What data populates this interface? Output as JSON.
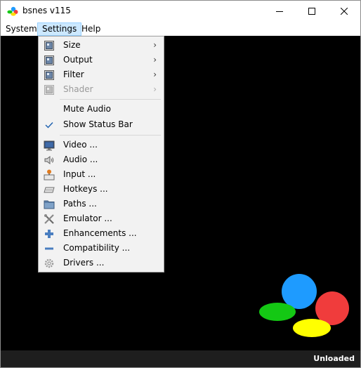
{
  "window": {
    "title": "bsnes v115"
  },
  "menubar": {
    "items": [
      {
        "label": "System"
      },
      {
        "label": "Settings"
      },
      {
        "label": "Help"
      }
    ]
  },
  "settings_menu": {
    "items": [
      {
        "label": "Size",
        "icon": "display-icon",
        "submenu": true,
        "enabled": true
      },
      {
        "label": "Output",
        "icon": "display-icon",
        "submenu": true,
        "enabled": true
      },
      {
        "label": "Filter",
        "icon": "display-icon",
        "submenu": true,
        "enabled": true
      },
      {
        "label": "Shader",
        "icon": "display-icon",
        "submenu": true,
        "enabled": false
      },
      {
        "label": "Mute Audio",
        "checked": false,
        "enabled": true
      },
      {
        "label": "Show Status Bar",
        "checked": true,
        "enabled": true
      },
      {
        "label": "Video ...",
        "icon": "monitor-icon",
        "enabled": true
      },
      {
        "label": "Audio ...",
        "icon": "speaker-icon",
        "enabled": true
      },
      {
        "label": "Input ...",
        "icon": "joystick-icon",
        "enabled": true
      },
      {
        "label": "Hotkeys ...",
        "icon": "keyboard-icon",
        "enabled": true
      },
      {
        "label": "Paths ...",
        "icon": "folder-icon",
        "enabled": true
      },
      {
        "label": "Emulator ...",
        "icon": "tools-icon",
        "enabled": true
      },
      {
        "label": "Enhancements ...",
        "icon": "plus-icon",
        "enabled": true
      },
      {
        "label": "Compatibility ...",
        "icon": "minus-icon",
        "enabled": true
      },
      {
        "label": "Drivers ...",
        "icon": "gear-icon",
        "enabled": true
      }
    ],
    "arrow_glyph": "›"
  },
  "statusbar": {
    "text": "Unloaded"
  },
  "colors": {
    "menu_highlight": "#cce8ff",
    "logo_blue": "#1e9bff",
    "logo_red": "#f03c3c",
    "logo_green": "#14c814",
    "logo_yellow": "#ffff00"
  }
}
